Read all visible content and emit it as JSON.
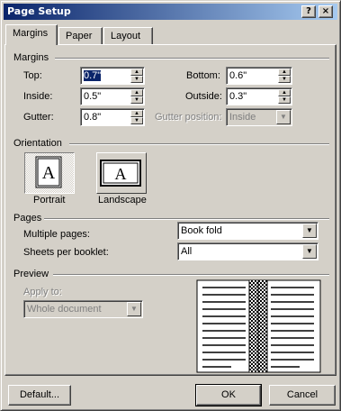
{
  "window": {
    "title": "Page Setup",
    "help_glyph": "?",
    "close_glyph": "×"
  },
  "tabs": [
    {
      "label": "Margins",
      "active": true
    },
    {
      "label": "Paper",
      "active": false
    },
    {
      "label": "Layout",
      "active": false
    }
  ],
  "margins": {
    "group_label": "Margins",
    "top": {
      "label": "Top:",
      "value": "0.7\""
    },
    "bottom": {
      "label": "Bottom:",
      "value": "0.6\""
    },
    "inside": {
      "label": "Inside:",
      "value": "0.5\""
    },
    "outside": {
      "label": "Outside:",
      "value": "0.3\""
    },
    "gutter": {
      "label": "Gutter:",
      "value": "0.8\""
    },
    "gutter_position": {
      "label": "Gutter position:",
      "value": "Inside"
    }
  },
  "orientation": {
    "group_label": "Orientation",
    "portrait_label": "Portrait",
    "landscape_label": "Landscape",
    "icon_letter": "A",
    "selected": "portrait"
  },
  "pages": {
    "group_label": "Pages",
    "multiple_pages": {
      "label": "Multiple pages:",
      "value": "Book fold"
    },
    "sheets_per_booklet": {
      "label": "Sheets per booklet:",
      "value": "All"
    }
  },
  "preview": {
    "group_label": "Preview",
    "apply_to_label": "Apply to:",
    "apply_to_value": "Whole document"
  },
  "buttons": {
    "default": "Default...",
    "ok": "OK",
    "cancel": "Cancel"
  },
  "colors": {
    "titlebar_start": "#0a246a",
    "titlebar_end": "#a6caf0",
    "face": "#d4d0c8"
  }
}
